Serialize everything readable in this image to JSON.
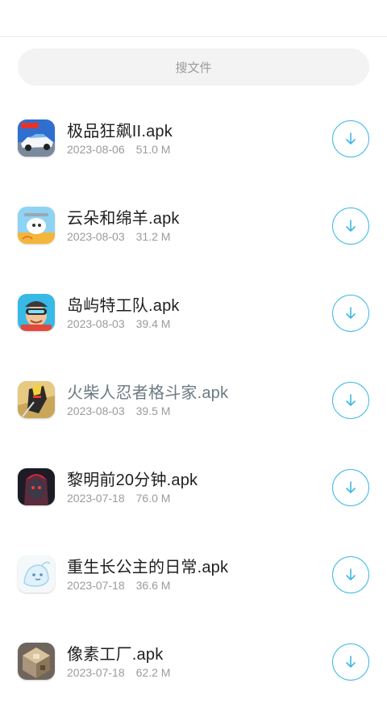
{
  "search": {
    "placeholder": "搜文件"
  },
  "accent_color": "#3db8e8",
  "files": [
    {
      "name": "极品狂飙II.apk",
      "date": "2023-08-06",
      "size": "51.0 M",
      "icon": "racing-car-app-icon"
    },
    {
      "name": "云朵和绵羊.apk",
      "date": "2023-08-03",
      "size": "31.2 M",
      "icon": "sheep-cloud-app-icon"
    },
    {
      "name": "岛屿特工队.apk",
      "date": "2023-08-03",
      "size": "39.4 M",
      "icon": "island-agent-app-icon"
    },
    {
      "name": "火柴人忍者格斗家.apk",
      "date": "2023-08-03",
      "size": "39.5 M",
      "icon": "stickman-ninja-app-icon"
    },
    {
      "name": "黎明前20分钟.apk",
      "date": "2023-07-18",
      "size": "76.0 M",
      "icon": "dawn-hunter-app-icon"
    },
    {
      "name": "重生长公主的日常.apk",
      "date": "2023-07-18",
      "size": "36.6 M",
      "icon": "princess-app-icon"
    },
    {
      "name": "像素工厂.apk",
      "date": "2023-07-18",
      "size": "62.2 M",
      "icon": "pixel-factory-app-icon"
    }
  ]
}
